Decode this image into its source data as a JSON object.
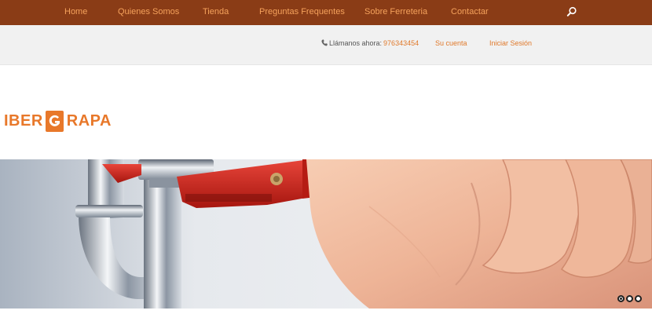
{
  "nav": {
    "items": [
      {
        "label": "Home"
      },
      {
        "label": "Quienes Somos"
      },
      {
        "label": "Tienda"
      },
      {
        "label": "Preguntas Frequentes"
      },
      {
        "label": "Sobre Ferreteria"
      },
      {
        "label": "Contactar"
      }
    ],
    "search_icon": "search-icon",
    "link_color": "#f5a25c",
    "background": "#8a3c16"
  },
  "topbar": {
    "call_label": "Llámanos ahora:",
    "phone": "976343454",
    "phone_icon": "phone-icon",
    "account_label": "Su cuenta",
    "login_label": "Iniciar Sesión",
    "accent": "#e07a2c"
  },
  "logo": {
    "left": "IBER",
    "right": "RAPA",
    "color": "#e8782a"
  },
  "slider": {
    "slide_count": 3,
    "active_slide": 1
  }
}
